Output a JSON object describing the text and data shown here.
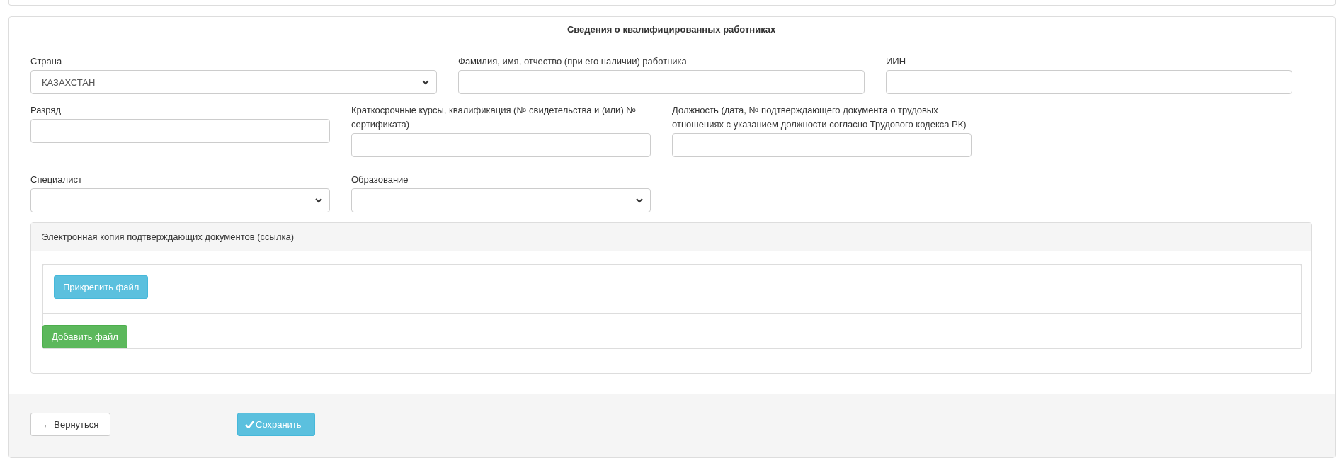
{
  "form": {
    "title": "Сведения о квалифицированных работниках",
    "rows": [
      {
        "fields": [
          {
            "kind": "select",
            "label": "Страна",
            "value": "КАЗАХСТАН"
          },
          {
            "kind": "text",
            "label": "Фамилия, имя, отчество (при его наличии) работника"
          },
          {
            "kind": "text",
            "label": "ИИН"
          }
        ]
      },
      {
        "fields": [
          {
            "kind": "text",
            "label": "Разряд"
          },
          {
            "kind": "text",
            "label": "Краткосрочные курсы, квалификация (№ свидетельства и (или) № сертификата)"
          },
          {
            "kind": "text",
            "label": "Должность (дата, № подтверждающего документа о трудовых отношениях с указанием должности согласно Трудового кодекса РК)"
          }
        ]
      },
      {
        "fields": [
          {
            "kind": "select",
            "label": "Специалист"
          },
          {
            "kind": "select",
            "label": "Образование"
          }
        ]
      }
    ],
    "attachments": {
      "title": "Электронная копия подтверждающих документов (ссылка)",
      "attach_button": "Прикрепить файл",
      "add_button": "Добавить файл"
    }
  },
  "footer": {
    "back_button": "← Вернуться",
    "save_button": "Сохранить"
  }
}
